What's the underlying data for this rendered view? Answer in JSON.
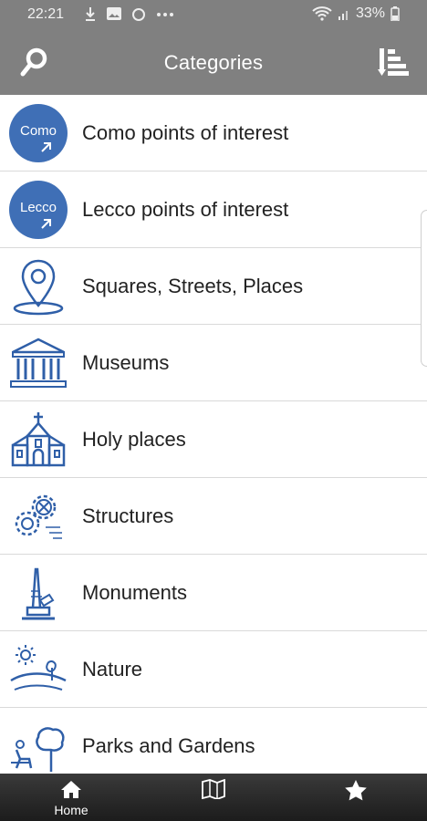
{
  "status_bar": {
    "time": "22:21",
    "battery": "33%"
  },
  "app_bar": {
    "title": "Categories",
    "search_icon": "search-icon",
    "sort_icon": "sort-list-icon"
  },
  "categories": [
    {
      "label": "Como points of interest",
      "icon": "como-badge-icon",
      "badge_text": "Como"
    },
    {
      "label": "Lecco points of interest",
      "icon": "lecco-badge-icon",
      "badge_text": "Lecco"
    },
    {
      "label": "Squares, Streets, Places",
      "icon": "map-pin-icon"
    },
    {
      "label": "Museums",
      "icon": "museum-icon"
    },
    {
      "label": "Holy places",
      "icon": "church-icon"
    },
    {
      "label": "Structures",
      "icon": "gears-icon"
    },
    {
      "label": "Monuments",
      "icon": "monument-icon"
    },
    {
      "label": "Nature",
      "icon": "nature-icon"
    },
    {
      "label": "Parks and Gardens",
      "icon": "park-icon"
    }
  ],
  "bottom_nav": {
    "home_label": "Home",
    "items": [
      "home-icon",
      "map-icon",
      "star-icon"
    ]
  },
  "colors": {
    "app_bar": "#808080",
    "accent_blue": "#3f6fb6",
    "bottom_nav": "#2a2a2a"
  }
}
